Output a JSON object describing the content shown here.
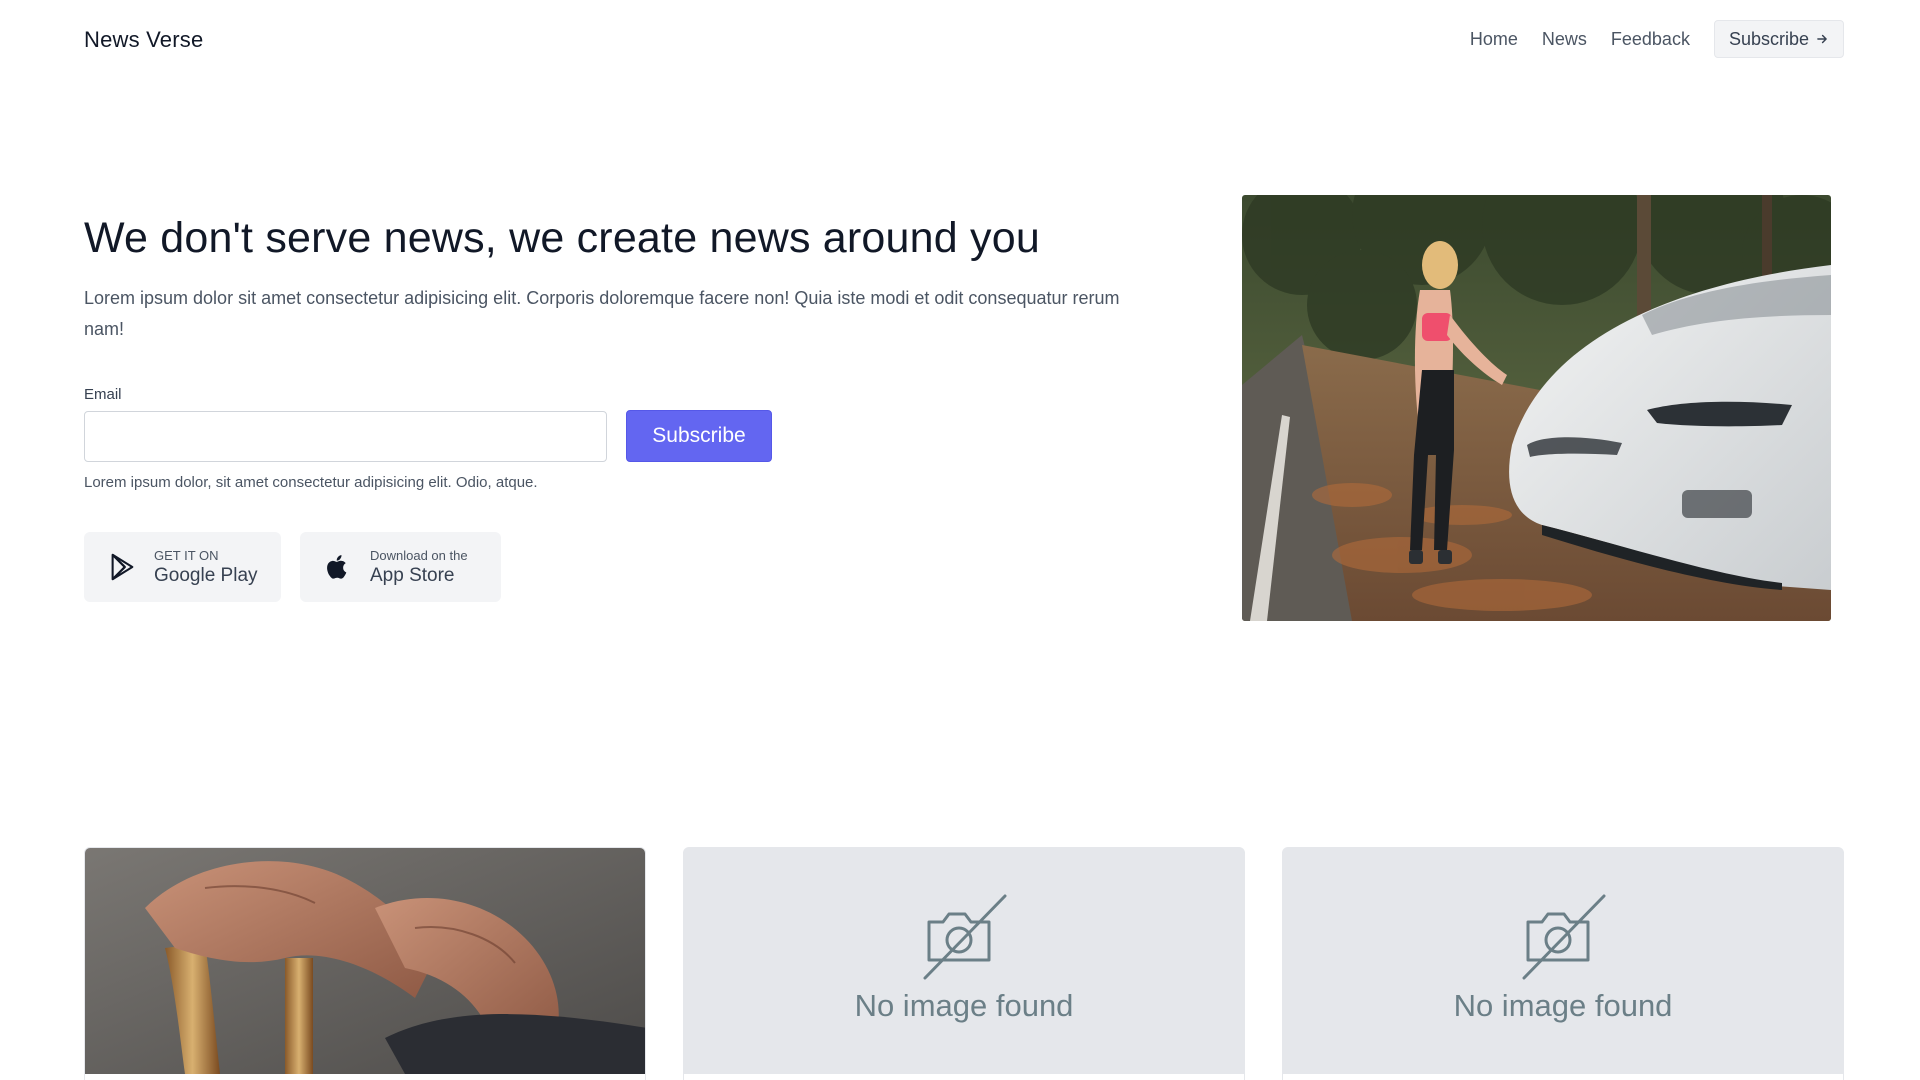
{
  "header": {
    "brand": "News Verse",
    "nav": [
      "Home",
      "News",
      "Feedback"
    ],
    "subscribe_label": "Subscribe"
  },
  "hero": {
    "title": "We don't serve news, we create news around you",
    "description": "Lorem ipsum dolor sit amet consectetur adipisicing elit. Corporis doloremque facere non! Quia iste modi et odit consequatur rerum nam!",
    "email_label": "Email",
    "email_value": "",
    "subscribe_button": "Subscribe",
    "helper": "Lorem ipsum dolor, sit amet consectetur adipisicing elit. Odio, atque.",
    "google_play": {
      "small": "GET IT ON",
      "big": "Google Play"
    },
    "app_store": {
      "small": "Download on the",
      "big": "App Store"
    }
  },
  "cards": [
    {
      "image": "hands-on-cane-photo"
    },
    {
      "placeholder": "No image found"
    },
    {
      "placeholder": "No image found"
    }
  ],
  "colors": {
    "accent": "#6366f1",
    "muted_text": "#4b5563",
    "placeholder_bg": "#e5e7eb"
  }
}
